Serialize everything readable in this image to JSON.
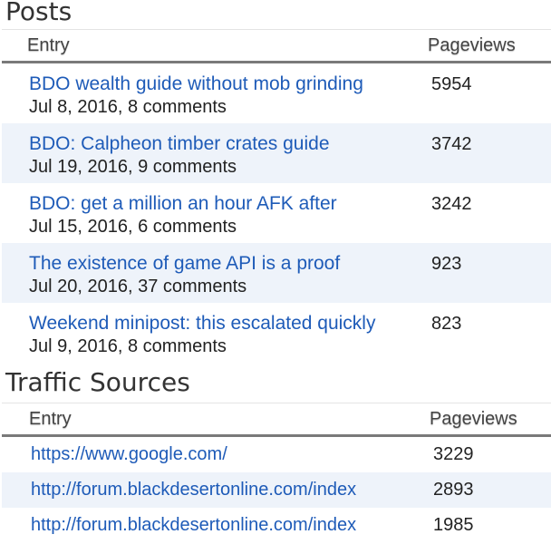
{
  "posts": {
    "title": "Posts",
    "columns": {
      "entry": "Entry",
      "pageviews": "Pageviews"
    },
    "rows": [
      {
        "title": "BDO wealth guide without mob grinding",
        "meta": "Jul 8, 2016, 8 comments",
        "pageviews": "5954"
      },
      {
        "title": "BDO: Calpheon timber crates guide",
        "meta": "Jul 19, 2016, 9 comments",
        "pageviews": "3742"
      },
      {
        "title": "BDO: get a million an hour AFK after",
        "meta": "Jul 15, 2016, 6 comments",
        "pageviews": "3242"
      },
      {
        "title": "The existence of game API is a proof",
        "meta": "Jul 20, 2016, 37 comments",
        "pageviews": "923"
      },
      {
        "title": "Weekend minipost: this escalated quickly",
        "meta": "Jul 9, 2016, 8 comments",
        "pageviews": "823"
      }
    ]
  },
  "traffic": {
    "title": "Traffic Sources",
    "columns": {
      "entry": "Entry",
      "pageviews": "Pageviews"
    },
    "rows": [
      {
        "url": "https://www.google.com/",
        "pageviews": "3229"
      },
      {
        "url": "http://forum.blackdesertonline.com/index",
        "pageviews": "2893"
      },
      {
        "url": "http://forum.blackdesertonline.com/index",
        "pageviews": "1985"
      }
    ]
  },
  "colors": {
    "link": "#1e5bb8",
    "alt_row": "#eef3fa",
    "header_rule": "#7a7a7a"
  }
}
